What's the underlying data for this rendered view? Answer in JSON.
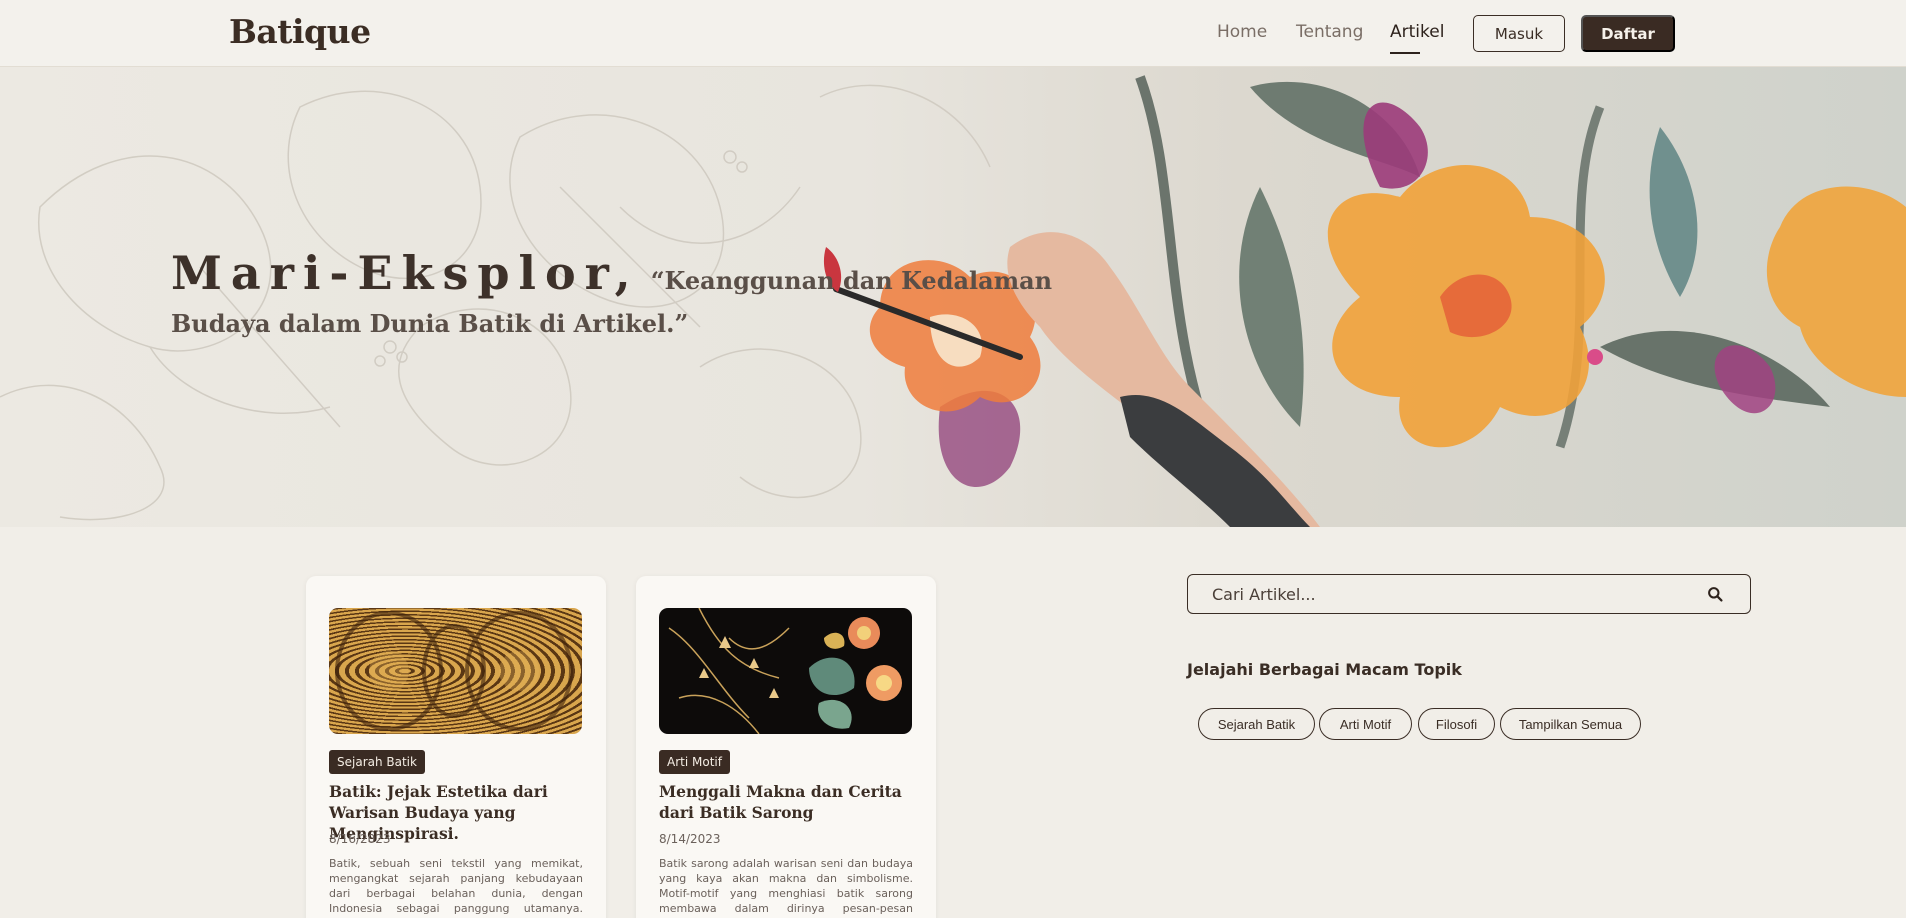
{
  "brand": {
    "logo": "Batique"
  },
  "nav": {
    "links": [
      {
        "label": "Home"
      },
      {
        "label": "Tentang"
      },
      {
        "label": "Artikel",
        "active": true
      }
    ],
    "login_label": "Masuk",
    "register_label": "Daftar"
  },
  "hero": {
    "title": "Mari-Eksplor,",
    "quote": "“Keanggunan dan Kedalaman Budaya dalam Dunia Batik di Artikel.”"
  },
  "articles": [
    {
      "tag": "Sejarah Batik",
      "title": "Batik: Jejak Estetika dari Warisan Budaya yang Menginspirasi.",
      "date": "8/16/2023",
      "excerpt": "Batik, sebuah seni tekstil yang memikat, mengangkat sejarah panjang kebudayaan dari berbagai belahan dunia, dengan Indonesia sebagai panggung utamanya. Sejarahnya"
    },
    {
      "tag": "Arti Motif",
      "title": "Menggali Makna dan Cerita dari Batik Sarong",
      "date": "8/14/2023",
      "excerpt": "Batik sarong adalah warisan seni dan budaya yang kaya akan makna dan simbolisme. Motif-motif yang menghiasi batik sarong membawa dalam dirinya pesan-pesan mendalam yang"
    }
  ],
  "sidebar": {
    "search_placeholder": "Cari Artikel...",
    "topics_heading": "Jelajahi Berbagai Macam Topik",
    "topics": [
      "Sejarah Batik",
      "Arti Motif",
      "Filosofi",
      "Tampilkan Semua"
    ]
  },
  "colors": {
    "background": "#f1eee8",
    "primary_dark": "#3a2b23",
    "text": "#3a2d25"
  }
}
